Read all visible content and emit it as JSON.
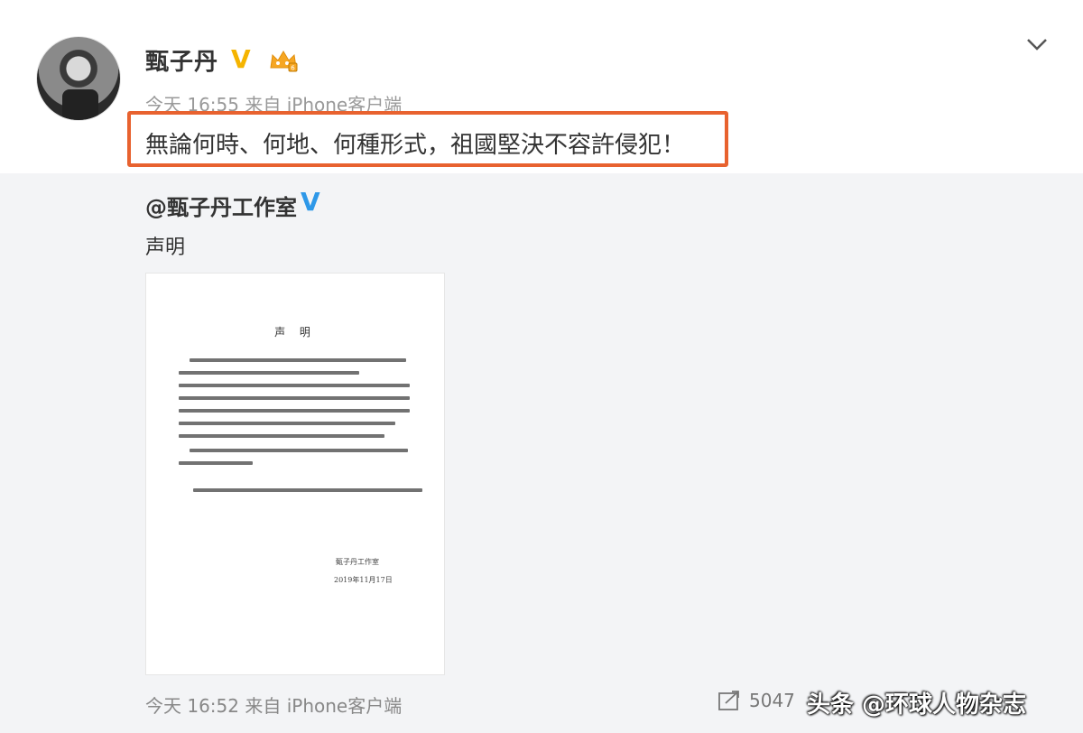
{
  "post": {
    "username": "甄子丹",
    "meta": "今天 16:55 来自 iPhone客户端",
    "text": "無論何時、何地、何種形式，祖國堅決不容許侵犯！"
  },
  "repost": {
    "author": "@甄子丹工作室",
    "text": "声明",
    "document": {
      "title": "声 明",
      "closing": "甄子丹工作室",
      "date": "2019年11月17日"
    },
    "meta": "今天 16:52 来自 iPhone客户端",
    "share_count": "5047"
  },
  "icons": {
    "verified": "verified-v-icon",
    "badge": "crown-badge-icon",
    "menu": "chevron-down-icon",
    "share": "share-icon"
  },
  "colors": {
    "highlight": "#e8622f",
    "verified_gold": "#f5b400",
    "verified_blue": "#2e98e8",
    "repost_bg": "#f3f4f6"
  },
  "watermark": "头条 @环球人物杂志"
}
